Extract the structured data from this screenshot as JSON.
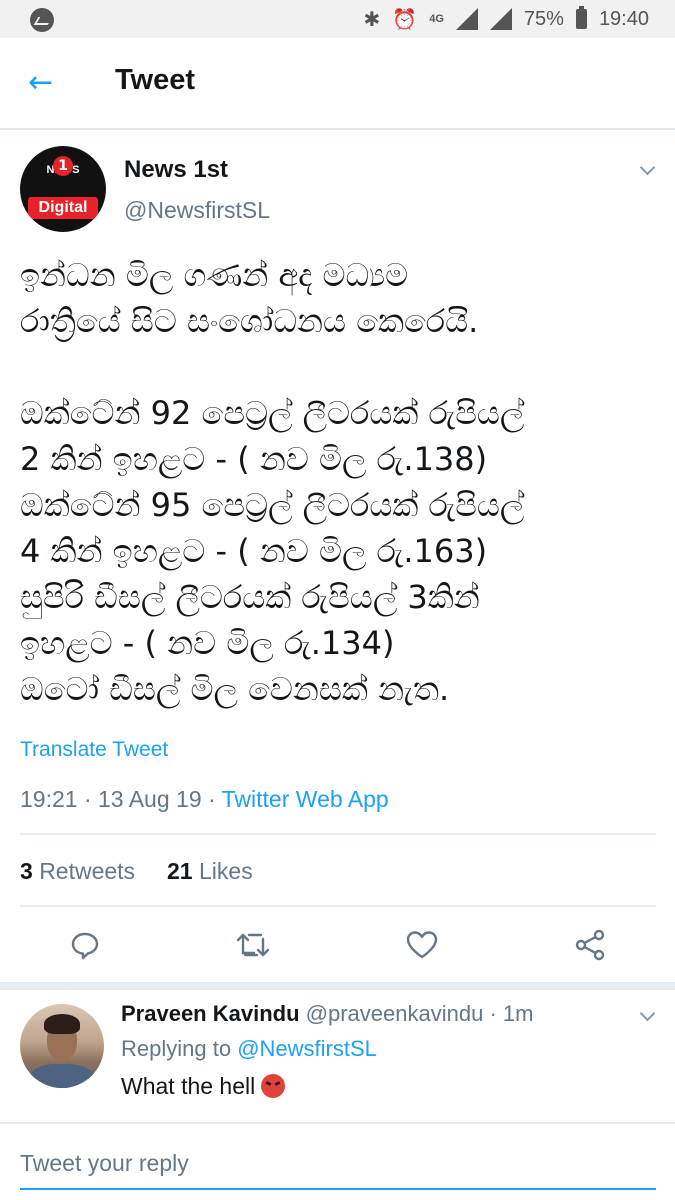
{
  "status_bar": {
    "network": "4G",
    "battery": "75%",
    "time": "19:40",
    "icons": [
      "messenger-icon",
      "bluetooth-icon",
      "alarm-icon",
      "signal-icon",
      "battery-icon"
    ]
  },
  "app_bar": {
    "title": "Tweet"
  },
  "tweet": {
    "author_name": "News 1st",
    "author_handle": "@NewsfirstSL",
    "avatar_text_top": "NEWS",
    "avatar_text_one": "1",
    "avatar_text_bottom": "Digital",
    "text": "ඉන්ධන මිල ගණන් අද මධ්‍යම\nරාත්‍රියේ සිට සංශෝධනය කෙරෙයි.\n\nඔක්ටේන් 92 පෙට්‍රල් ලීටරයක් රුපියල්\n2 කින් ඉහළට - ( නව මිල රු.138)\nඔක්ටේන් 95 පෙට්‍රල් ලීටරයක් රුපියල්\n4 කින් ඉහළට - ( නව මිල රු.163)\nසුපිරි ඩීසල් ලීටරයක් රුපියල් 3කින්\nඉහළට - ( නව මිල රු.134)\nඔටෝ ඩීසල් මිල වෙනසක් නැත.",
    "translate_label": "Translate Tweet",
    "time": "19:21",
    "date": "13 Aug 19",
    "source": "Twitter Web App",
    "retweets_count": "3",
    "retweets_label": "Retweets",
    "likes_count": "21",
    "likes_label": "Likes"
  },
  "reply": {
    "name": "Praveen Kavindu",
    "handle": "@praveenkavindu",
    "age": "1m",
    "replying_label": "Replying to",
    "replying_handle": "@NewsfirstSL",
    "text": "What the hell"
  },
  "compose": {
    "placeholder": "Tweet your reply"
  },
  "colors": {
    "accent": "#1da1f2",
    "muted": "#657786",
    "text": "#14171a",
    "divider": "#e6ecf0"
  }
}
